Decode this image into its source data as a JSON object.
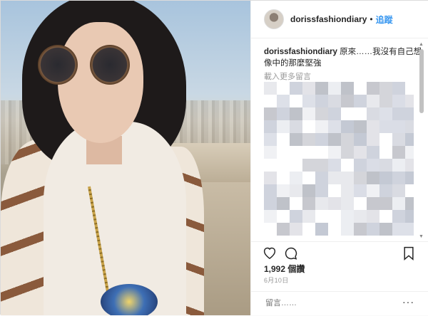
{
  "header": {
    "username": "dorissfashiondiary",
    "separator": "•",
    "follow_label": "追蹤"
  },
  "caption": {
    "username": "dorissfashiondiary",
    "text": "原來……我沒有自己想像中的那麼堅強"
  },
  "comments": {
    "load_more": "載入更多留言"
  },
  "actions": {
    "like_icon": "heart-icon",
    "comment_icon": "comment-icon",
    "save_icon": "bookmark-icon"
  },
  "likes": "1,992 個讚",
  "date": "6月10日",
  "comment_box": {
    "placeholder": "留言……",
    "more": "···"
  }
}
